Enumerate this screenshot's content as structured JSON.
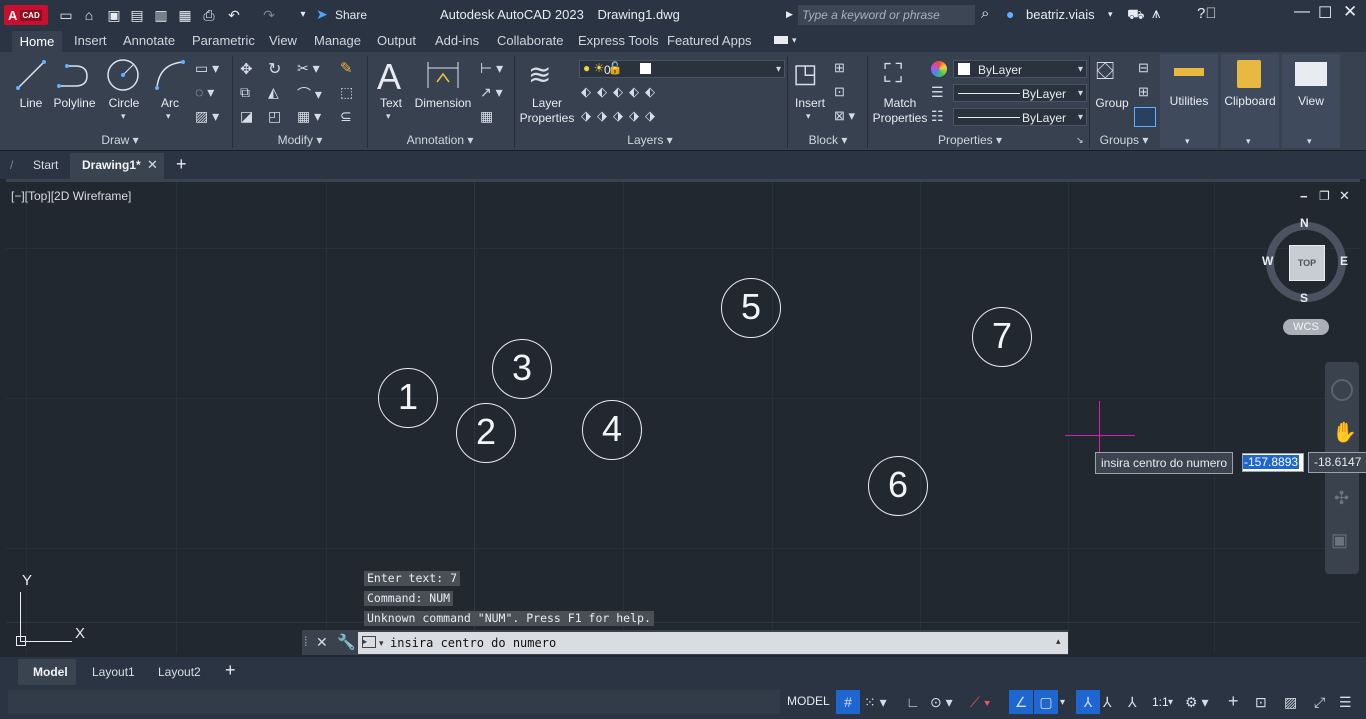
{
  "title_bar": {
    "logo_main": "A",
    "logo_sub": "CAD",
    "share_label": "Share",
    "app_title": "Autodesk AutoCAD 2023",
    "file_name": "Drawing1.dwg",
    "search_placeholder": "Type a keyword or phrase",
    "user_name": "beatriz.viais"
  },
  "ribbon_tabs": [
    "Home",
    "Insert",
    "Annotate",
    "Parametric",
    "View",
    "Manage",
    "Output",
    "Add-ins",
    "Collaborate",
    "Express Tools",
    "Featured Apps"
  ],
  "ribbon": {
    "draw": {
      "panel": "Draw",
      "line": "Line",
      "polyline": "Polyline",
      "circle": "Circle",
      "arc": "Arc"
    },
    "modify": {
      "panel": "Modify"
    },
    "annotation": {
      "panel": "Annotation",
      "text": "Text",
      "dimension": "Dimension"
    },
    "layers": {
      "panel": "Layers",
      "layer_properties_1": "Layer",
      "layer_properties_2": "Properties",
      "current_layer": "0"
    },
    "block": {
      "panel": "Block",
      "insert": "Insert"
    },
    "properties": {
      "panel": "Properties",
      "match_1": "Match",
      "match_2": "Properties",
      "color": "ByLayer",
      "lineweight": "ByLayer",
      "linetype": "ByLayer"
    },
    "groups": {
      "panel": "Groups",
      "group": "Group"
    },
    "utilities": "Utilities",
    "clipboard": "Clipboard",
    "view": "View"
  },
  "doc_tabs": {
    "start": "Start",
    "active": "Drawing1*"
  },
  "viewport_label": "[−][Top][2D Wireframe]",
  "viewcube": {
    "n": "N",
    "s": "S",
    "e": "E",
    "w": "W",
    "face": "TOP",
    "wcs": "WCS"
  },
  "ucs": {
    "y": "Y",
    "x": "X"
  },
  "canvas_numbers": [
    "1",
    "2",
    "3",
    "4",
    "5",
    "6",
    "7"
  ],
  "command_history": [
    "Enter text: 7",
    "Command: NUM",
    "Unknown command \"NUM\".  Press F1 for help."
  ],
  "command_prompt": "insira centro do numero",
  "cursor_tooltip": {
    "prompt": "insira centro do numero",
    "x_value": "-157.8893",
    "y_value": "-18.6147"
  },
  "layout_tabs": [
    "Model",
    "Layout1",
    "Layout2"
  ],
  "status_bar": {
    "mode": "MODEL",
    "scale": "1:1"
  },
  "colors": {
    "background": "#212830",
    "crosshair": "#d61fb4",
    "selection": "#1e66d0",
    "logo": "#c8102e"
  }
}
